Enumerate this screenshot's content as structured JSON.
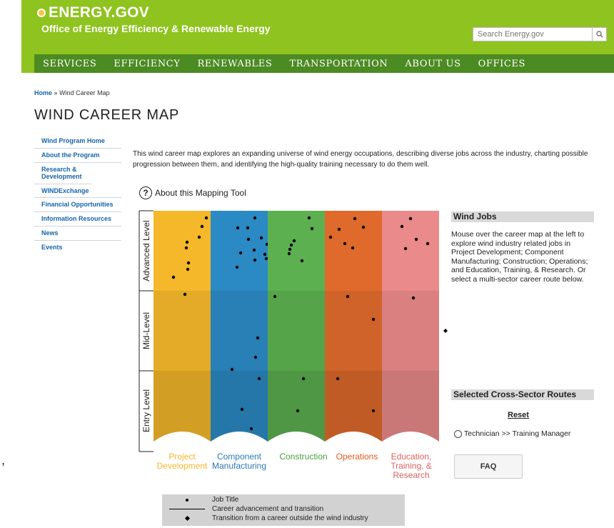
{
  "header": {
    "logo_text": "ENERGY.GOV",
    "office_name": "Office of Energy Efficiency & Renewable Energy",
    "search_placeholder": "Search Energy.gov",
    "brand_color": "#8fc31f",
    "nav_color": "#4c8a22"
  },
  "nav": {
    "items": [
      {
        "label": "SERVICES"
      },
      {
        "label": "EFFICIENCY"
      },
      {
        "label": "RENEWABLES"
      },
      {
        "label": "TRANSPORTATION"
      },
      {
        "label": "ABOUT US"
      },
      {
        "label": "OFFICES"
      }
    ]
  },
  "breadcrumb": {
    "home": "Home",
    "separator": "»",
    "current": "Wind Career Map"
  },
  "page_title": "WIND CAREER MAP",
  "sidebar": {
    "items": [
      {
        "label": "Wind Program Home"
      },
      {
        "label": "About the Program"
      },
      {
        "label": "Research & Development"
      },
      {
        "label": "WINDExchange"
      },
      {
        "label": "Financial Opportunities"
      },
      {
        "label": "Information Resources"
      },
      {
        "label": "News"
      },
      {
        "label": "Events"
      }
    ]
  },
  "intro": "This wind career map explores an expanding universe of wind energy occupations, describing diverse jobs across the industry, charting possible progression between them, and identifying the high-quality training necessary to do them well.",
  "about_tool": "About this Mapping Tool",
  "map": {
    "levels": [
      "Advanced Level",
      "Mid-Level",
      "Entry Level"
    ],
    "sectors": [
      {
        "label": "Project Development",
        "color": "#f4b82a",
        "dots": [
          [
            74,
            10
          ],
          [
            68,
            22
          ],
          [
            64,
            37
          ],
          [
            47,
            44
          ],
          [
            46,
            52
          ],
          [
            87,
            66
          ],
          [
            49,
            73
          ],
          [
            48,
            82
          ],
          [
            28,
            93
          ],
          [
            44,
            117
          ]
        ]
      },
      {
        "label": "Component Manufacturing",
        "color": "#2b8ac4",
        "dots": [
          [
            62,
            10
          ],
          [
            38,
            24
          ],
          [
            52,
            24
          ],
          [
            71,
            38
          ],
          [
            53,
            40
          ],
          [
            79,
            47
          ],
          [
            42,
            59
          ],
          [
            61,
            55
          ],
          [
            76,
            61
          ],
          [
            78,
            67
          ],
          [
            62,
            69
          ],
          [
            37,
            79
          ],
          [
            66,
            178
          ],
          [
            63,
            205
          ],
          [
            30,
            222
          ],
          [
            68,
            235
          ],
          [
            44,
            278
          ],
          [
            57,
            305
          ]
        ]
      },
      {
        "label": "Construction",
        "color": "#5cb050",
        "dots": [
          [
            58,
            10
          ],
          [
            62,
            25
          ],
          [
            37,
            42
          ],
          [
            33,
            48
          ],
          [
            31,
            54
          ],
          [
            30,
            60
          ],
          [
            48,
            70
          ],
          [
            10,
            120
          ],
          [
            50,
            235
          ],
          [
            42,
            280
          ]
        ]
      },
      {
        "label": "Operations",
        "color": "#e06a2c",
        "dots": [
          [
            42,
            11
          ],
          [
            54,
            23
          ],
          [
            20,
            26
          ],
          [
            8,
            37
          ],
          [
            28,
            46
          ],
          [
            39,
            52
          ],
          [
            32,
            120
          ],
          [
            68,
            152
          ],
          [
            18,
            235
          ],
          [
            68,
            280
          ]
        ]
      },
      {
        "label": "Education, Training, & Research",
        "color": "#ea8a8a",
        "dots": [
          [
            40,
            11
          ],
          [
            28,
            22
          ],
          [
            48,
            40
          ],
          [
            64,
            46
          ],
          [
            33,
            53
          ],
          [
            44,
            122
          ]
        ]
      }
    ]
  },
  "wind_jobs": {
    "title": "Wind Jobs",
    "description": "Mouse over the career map at the left to explore wind industry related jobs in Project Development; Component Manufacturing; Construction; Operations; and Education, Training, & Research. Or select a multi-sector career route below."
  },
  "cross_sector": {
    "title": "Selected Cross-Sector Routes",
    "reset": "Reset",
    "route": "Technician >> Training Manager",
    "faq": "FAQ"
  },
  "legend": {
    "items": [
      {
        "symbol": "dot",
        "label": "Job Title"
      },
      {
        "symbol": "line",
        "label": "Career advancement and transition"
      },
      {
        "symbol": "diamond",
        "label": "Transition from a career outside the wind industry"
      }
    ]
  },
  "stray_mark": ","
}
